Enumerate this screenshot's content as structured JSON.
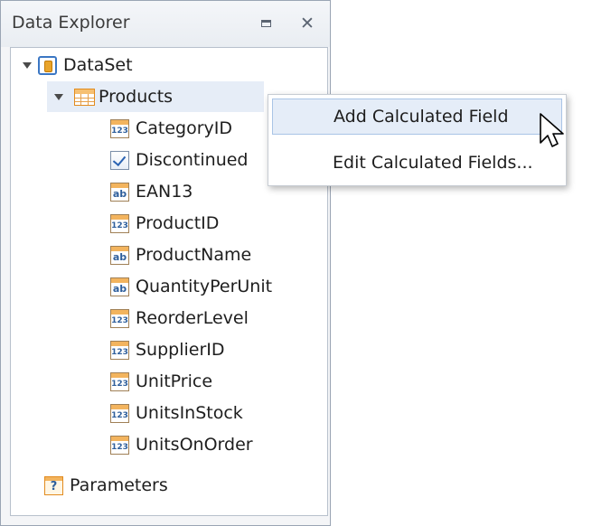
{
  "panel": {
    "title": "Data Explorer"
  },
  "tree": {
    "dataset": {
      "label": "DataSet",
      "icon": "dataset-icon"
    },
    "table": {
      "label": "Products",
      "icon": "table-icon",
      "selected": true
    },
    "fields": [
      {
        "label": "CategoryID",
        "type": "number"
      },
      {
        "label": "Discontinued",
        "type": "boolean"
      },
      {
        "label": "EAN13",
        "type": "text"
      },
      {
        "label": "ProductID",
        "type": "number"
      },
      {
        "label": "ProductName",
        "type": "text"
      },
      {
        "label": "QuantityPerUnit",
        "type": "text"
      },
      {
        "label": "ReorderLevel",
        "type": "number"
      },
      {
        "label": "SupplierID",
        "type": "number"
      },
      {
        "label": "UnitPrice",
        "type": "number"
      },
      {
        "label": "UnitsInStock",
        "type": "number"
      },
      {
        "label": "UnitsOnOrder",
        "type": "number"
      }
    ],
    "parameters": {
      "label": "Parameters",
      "icon": "parameters-icon"
    }
  },
  "context_menu": {
    "items": [
      {
        "label": "Add Calculated Field",
        "hovered": true
      },
      {
        "label": "Edit Calculated Fields...",
        "hovered": false
      }
    ]
  },
  "colors": {
    "accent": "#3b77c4",
    "hover": "#e5edf8",
    "selection": "#e6edf7"
  }
}
